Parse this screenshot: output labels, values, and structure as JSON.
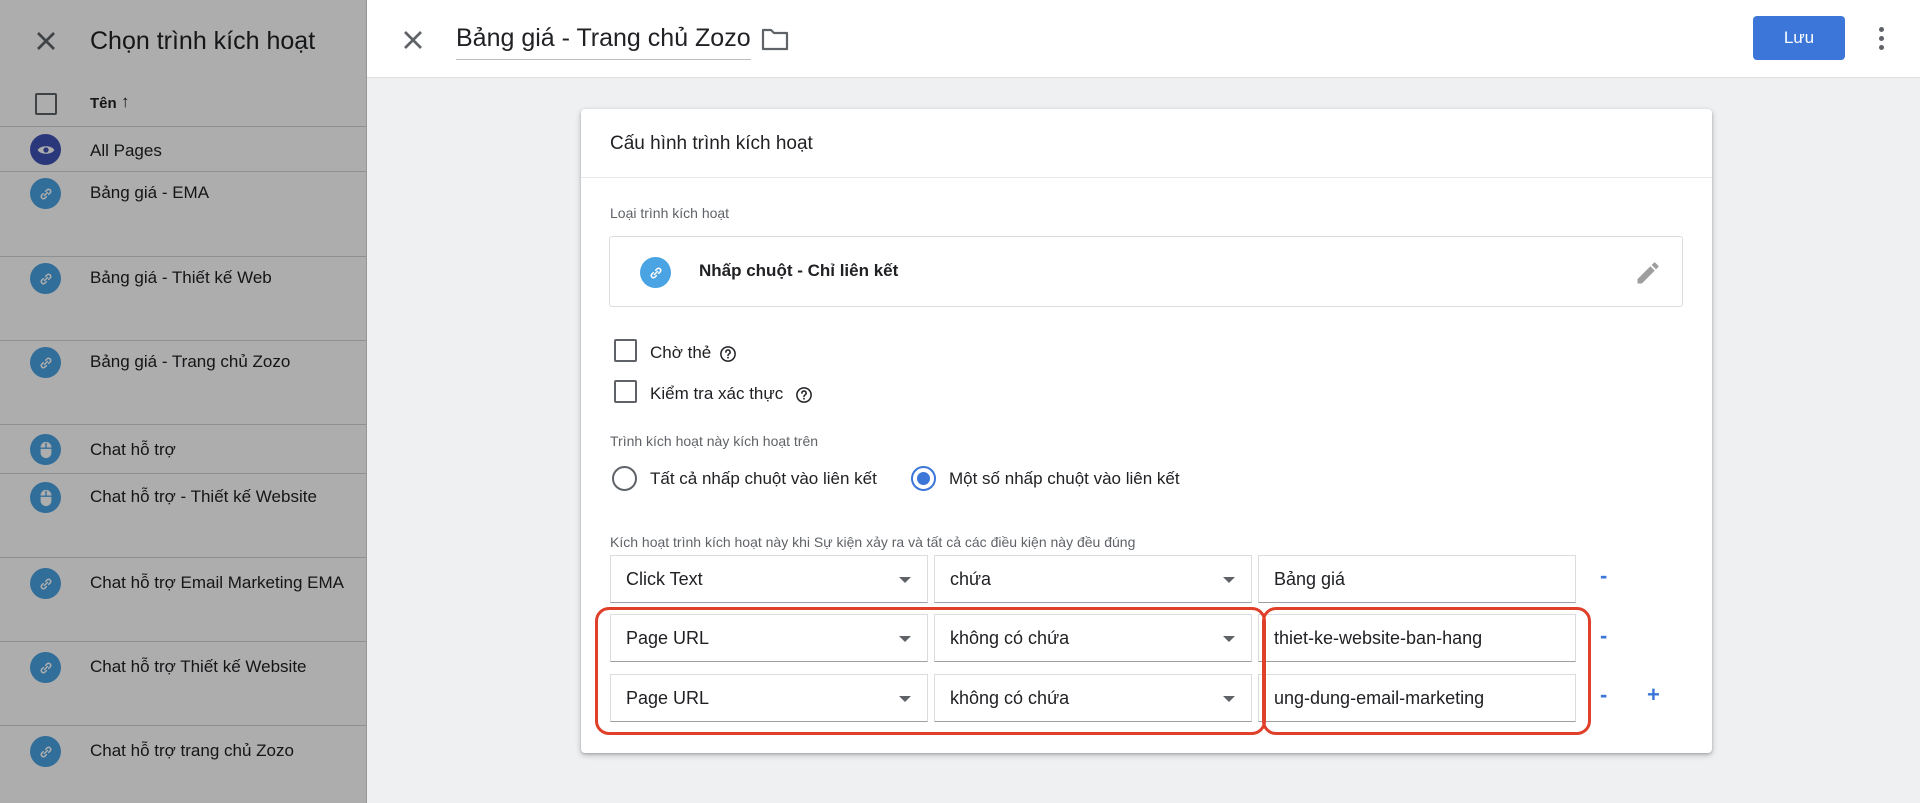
{
  "left_panel": {
    "title": "Chọn trình kích hoạt",
    "column_header": "Tên",
    "sort_icon": "↑",
    "items": [
      {
        "label": "All Pages",
        "icon": "eye-icon"
      },
      {
        "label": "Bảng giá - EMA",
        "icon": "link-icon"
      },
      {
        "label": "Bảng giá - Thiết kế Web",
        "icon": "link-icon"
      },
      {
        "label": "Bảng giá - Trang chủ Zozo",
        "icon": "link-icon"
      },
      {
        "label": "Chat hỗ trợ",
        "icon": "mouse-icon"
      },
      {
        "label": "Chat hỗ trợ - Thiết kế Website",
        "icon": "mouse-icon"
      },
      {
        "label": "Chat hỗ trợ Email Marketing EMA",
        "icon": "link-icon"
      },
      {
        "label": "Chat hỗ trợ Thiết kế Website",
        "icon": "link-icon"
      },
      {
        "label": "Chat hỗ trợ trang chủ Zozo",
        "icon": "link-icon"
      }
    ]
  },
  "topbar": {
    "tag_name": "Bảng giá - Trang chủ Zozo",
    "save_label": "Lưu"
  },
  "card": {
    "title": "Cấu hình trình kích hoạt",
    "type_section_label": "Loại trình kích hoạt",
    "type_label": "Nhấp chuột - Chỉ liên kết",
    "checkboxes": [
      {
        "label": "Chờ thẻ",
        "checked": false
      },
      {
        "label": "Kiểm tra xác thực",
        "checked": false
      }
    ],
    "fire_on_label": "Trình kích hoạt này kích hoạt trên",
    "radio_options": [
      {
        "label": "Tất cả nhấp chuột vào liên kết",
        "selected": false
      },
      {
        "label": "Một số nhấp chuột vào liên kết",
        "selected": true
      }
    ],
    "conditions_label": "Kích hoạt trình kích hoạt này khi Sự kiện xảy ra và tất cả các điều kiện này đều đúng",
    "conditions": [
      {
        "variable": "Click Text",
        "operator": "chứa",
        "value": "Bảng giá"
      },
      {
        "variable": "Page URL",
        "operator": "không có chứa",
        "value": "thiet-ke-website-ban-hang"
      },
      {
        "variable": "Page URL",
        "operator": "không có chứa",
        "value": "ung-dung-email-marketing"
      }
    ],
    "remove_symbol": "-",
    "add_symbol": "+"
  },
  "colors": {
    "accent": "#3b76d8",
    "highlight": "#e0402a",
    "icon_blue": "#4aa3e3",
    "eye_icon_bg": "#3f51b5"
  }
}
